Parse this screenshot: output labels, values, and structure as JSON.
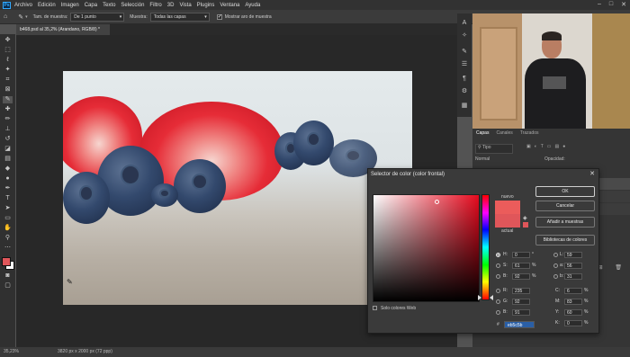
{
  "menu": [
    "Archivo",
    "Edición",
    "Imagen",
    "Capa",
    "Texto",
    "Selección",
    "Filtro",
    "3D",
    "Vista",
    "Plugins",
    "Ventana",
    "Ayuda"
  ],
  "app_logo": "Ps",
  "window_controls": [
    "–",
    "□",
    "✕"
  ],
  "options_bar": {
    "sample_size_label": "Tam. de muestra:",
    "sample_size_value": "De 1 punto",
    "sample_label": "Muestra:",
    "sample_value": "Todas las capas",
    "show_ring_label": "Mostrar aro de muestra"
  },
  "document_tab": "b468.psd al 35,2% (Arandano, RGB/8) *",
  "status": {
    "zoom": "35,23%",
    "doc_info": "3820 px x 2000 px (72 ppp)"
  },
  "layers_panel": {
    "tabs": [
      "Capas",
      "Canales",
      "Trazados"
    ],
    "active_tab": "Capas",
    "search_placeholder": "Tipo",
    "blend_mode": "Normal",
    "opacity_label": "Opacidad:"
  },
  "dialog": {
    "title": "Selector de color (color frontal)",
    "new_label": "nuevo",
    "current_label": "actual",
    "ok": "OK",
    "cancel": "Cancelar",
    "add_swatches": "Añadir a muestras",
    "libraries": "Bibliotecas de colores",
    "web_only": "Solo colores Web",
    "new_color": "#eb5c5b",
    "current_color": "#e0565a",
    "hsb": [
      {
        "label": "H:",
        "value": "0",
        "unit": "°"
      },
      {
        "label": "S:",
        "value": "61",
        "unit": "%"
      },
      {
        "label": "B:",
        "value": "92",
        "unit": "%"
      }
    ],
    "rgb": [
      {
        "label": "R:",
        "value": "235"
      },
      {
        "label": "G:",
        "value": "92"
      },
      {
        "label": "B:",
        "value": "91"
      }
    ],
    "lab": [
      {
        "label": "L:",
        "value": "59"
      },
      {
        "label": "a:",
        "value": "56"
      },
      {
        "label": "b:",
        "value": "31"
      }
    ],
    "cmyk": [
      {
        "label": "C:",
        "value": "6",
        "unit": "%"
      },
      {
        "label": "M:",
        "value": "83",
        "unit": "%"
      },
      {
        "label": "Y:",
        "value": "60",
        "unit": "%"
      },
      {
        "label": "K:",
        "value": "0",
        "unit": "%"
      }
    ],
    "hex_label": "#",
    "hex_value": "eb5c5b"
  },
  "right_column_icons": [
    "ai-icon",
    "bulb-icon",
    "brush-icon",
    "adjust-icon",
    "paragraph-icon",
    "settings-icon",
    "layers-icon",
    "grid-icon"
  ],
  "colors": {
    "foreground": "#e0565a",
    "background": "#ffffff",
    "accent": "#31a8ff"
  }
}
